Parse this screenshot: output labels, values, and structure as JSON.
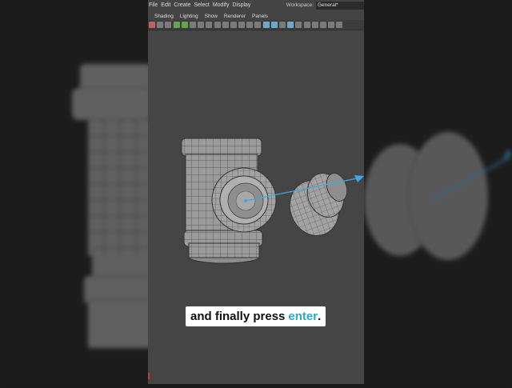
{
  "menubar": {
    "items": [
      "File",
      "Edit",
      "Create",
      "Select",
      "Modify",
      "Display"
    ],
    "workspace_label": "Workspace:",
    "workspace_value": "General*"
  },
  "panel_menu": {
    "items": [
      "Shading",
      "Lighting",
      "Show",
      "Renderer",
      "Panels"
    ]
  },
  "toolbar": {
    "icons": [
      "select-tool-icon",
      "lasso-icon",
      "paint-select-icon",
      "move-icon",
      "rotate-icon",
      "scale-icon",
      "grid-icon",
      "wireframe-icon",
      "camera-icon",
      "frame-icon",
      "film-gate-icon",
      "resolution-gate-icon",
      "safe-action-icon",
      "field-chart-icon",
      "isolate-icon",
      "xray-icon",
      "wireframe-on-shaded-icon",
      "smooth-shade-icon",
      "textured-icon",
      "lights-icon",
      "shadows-icon",
      "ambient-occlusion-icon",
      "motion-blur-icon",
      "anti-alias-icon"
    ]
  },
  "caption": {
    "text": "and finally press",
    "highlight": "enter",
    "punct": "."
  },
  "colors": {
    "caption_highlight": "#2aa7cf",
    "viewport_bg": "#454545",
    "axis_line": "#3fa9e0"
  }
}
